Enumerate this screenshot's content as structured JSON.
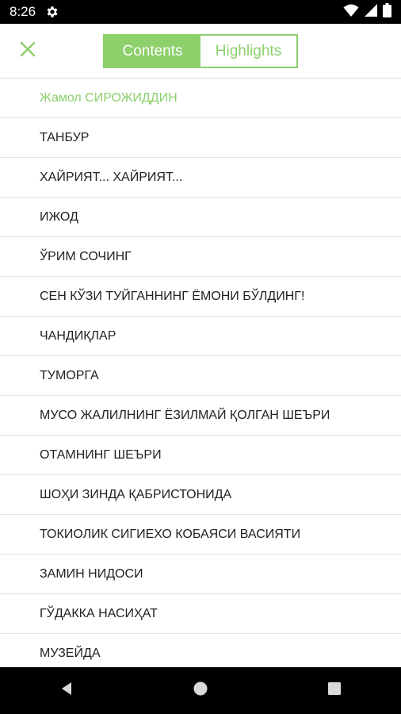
{
  "status_bar": {
    "time": "8:26",
    "icons": [
      "gear-icon",
      "wifi-icon",
      "signal-icon",
      "battery-icon"
    ]
  },
  "toolbar": {
    "close_icon": "close-icon",
    "tabs": [
      {
        "label": "Contents",
        "active": true
      },
      {
        "label": "Highlights",
        "active": false
      }
    ]
  },
  "contents": [
    "Жамол СИРОЖИДДИН",
    "ТАНБУР",
    "ХАЙРИЯТ... ХАЙРИЯТ...",
    "ИЖОД",
    "ЎРИМ СОЧИНГ",
    "СЕН КЎЗИ ТУЙГАННИНГ ЁМОНИ БЎЛДИНГ!",
    "ЧАНДИҚЛАР",
    "ТУМОРГА",
    "МУСО ЖАЛИЛНИНГ ЁЗИЛМАЙ ҚОЛГАН ШЕЪРИ",
    "ОТАМНИНГ ШЕЪРИ",
    "ШОҲИ ЗИНДА ҚАБРИСТОНИДА",
    "ТОКИОЛИК СИГИЕХО КОБАЯСИ ВАСИЯТИ",
    "ЗАМИН НИДОСИ",
    "ГЎДАККА НАСИҲАТ",
    "МУЗЕЙДА"
  ],
  "nav_bar": {
    "icons": [
      "back-icon",
      "home-icon",
      "recents-icon"
    ]
  },
  "colors": {
    "accent": "#8ccf6b",
    "text": "#222222",
    "divider": "#e3e3e3"
  }
}
